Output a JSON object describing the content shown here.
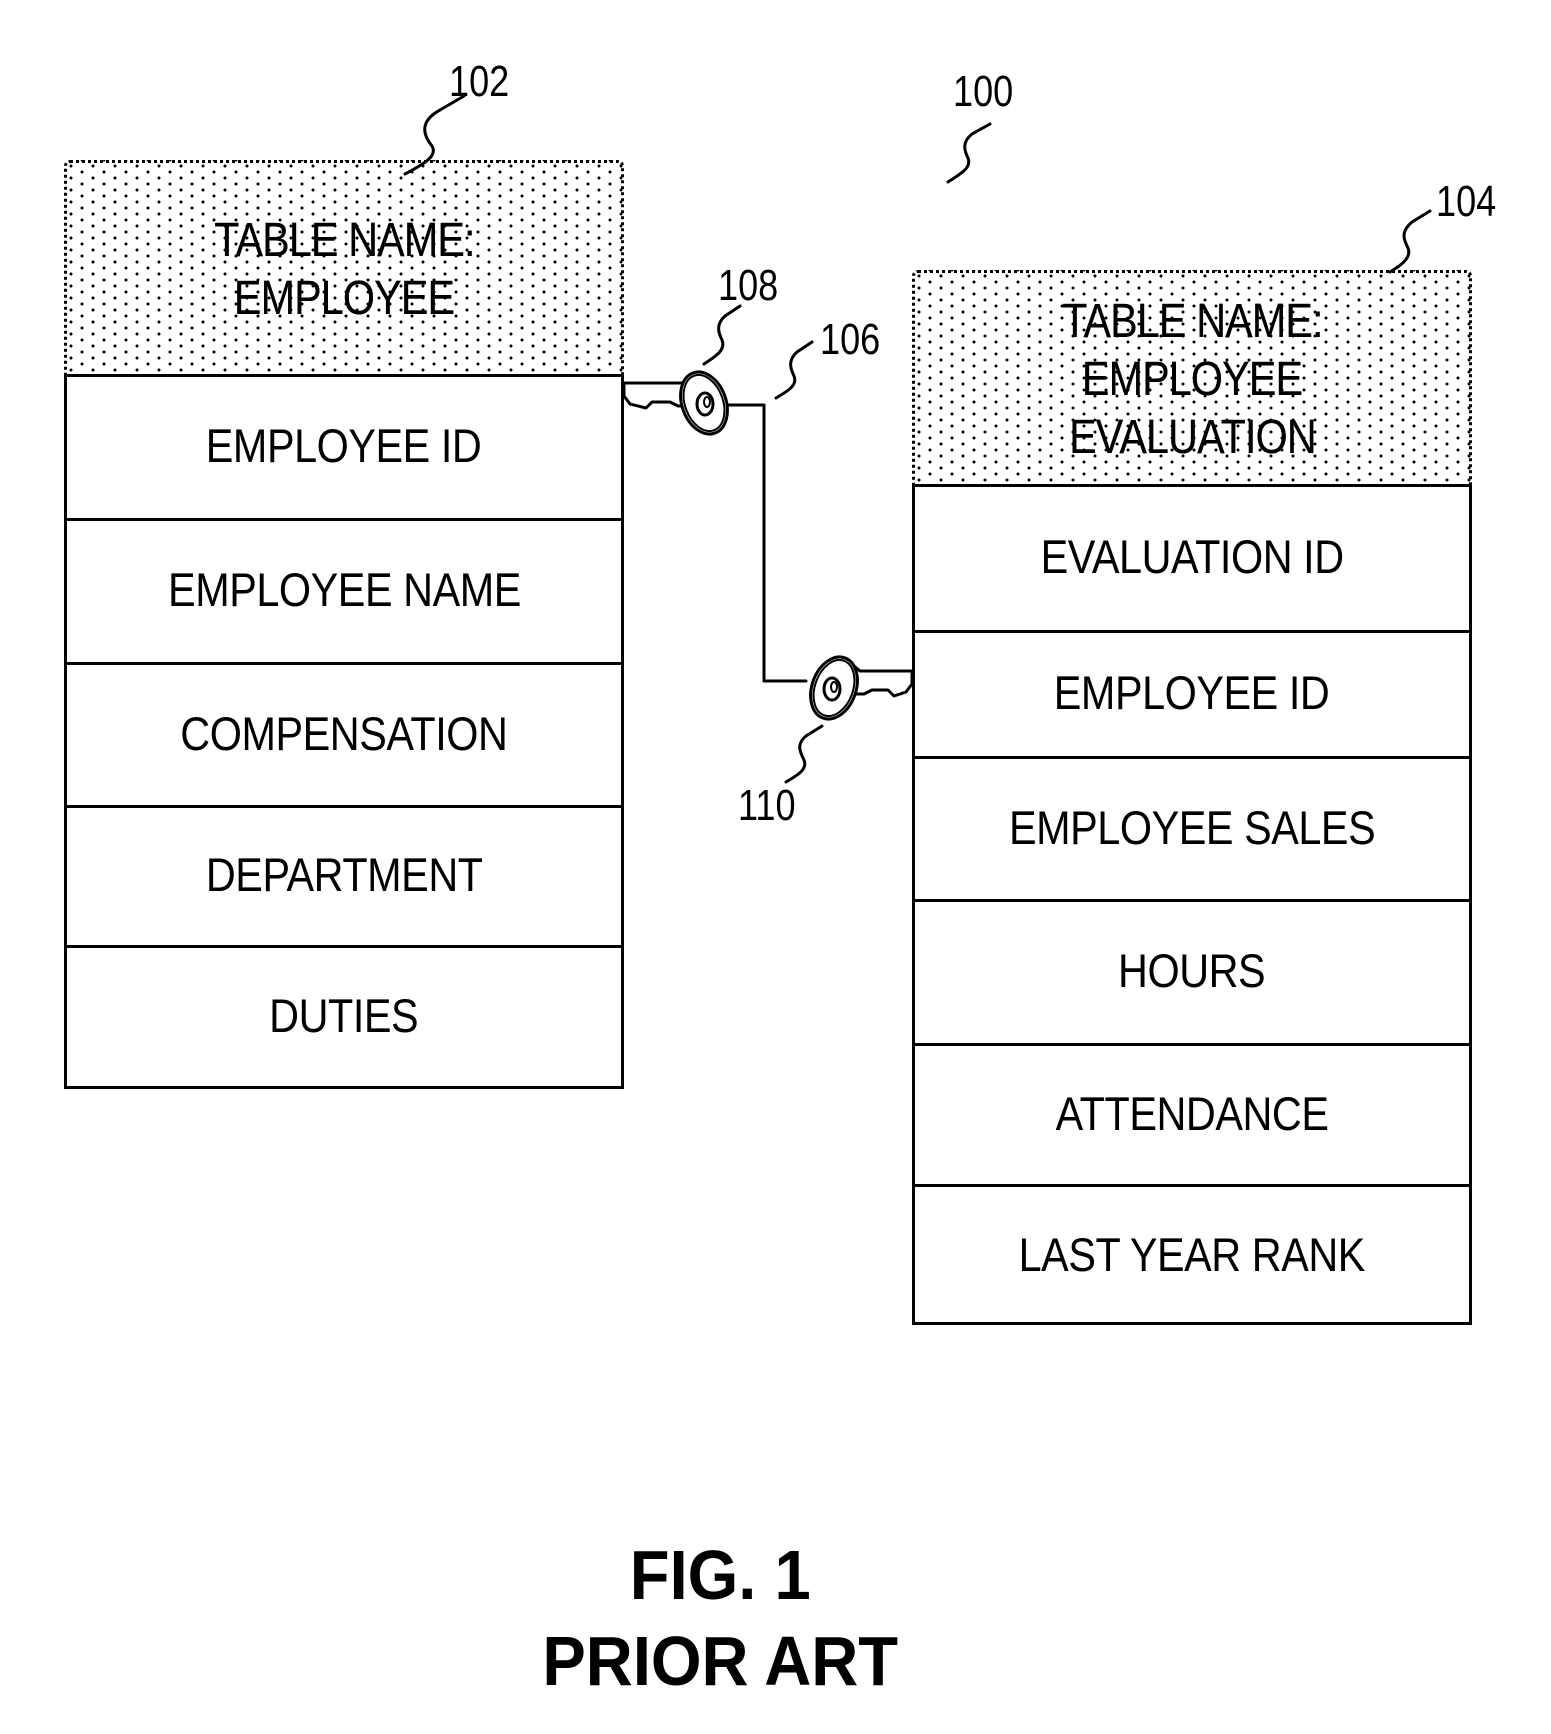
{
  "figure": {
    "reference_number": "100",
    "caption_line1": "FIG. 1",
    "caption_line2": "PRIOR ART"
  },
  "tables": [
    {
      "reference_number": "102",
      "header_lines": [
        "TABLE NAME:",
        "EMPLOYEE"
      ],
      "fields": [
        "EMPLOYEE ID",
        "EMPLOYEE NAME",
        "COMPENSATION",
        "DEPARTMENT",
        "DUTIES"
      ]
    },
    {
      "reference_number": "104",
      "header_lines": [
        "TABLE NAME:",
        "EMPLOYEE",
        "EVALUATION"
      ],
      "fields": [
        "EVALUATION ID",
        "EMPLOYEE ID",
        "EMPLOYEE SALES",
        "HOURS",
        "ATTENDANCE",
        "LAST YEAR RANK"
      ]
    }
  ],
  "relationship": {
    "reference_number": "106",
    "primary_key": {
      "reference_number": "108",
      "icon": "key-icon"
    },
    "foreign_key": {
      "reference_number": "110",
      "icon": "key-icon"
    }
  }
}
